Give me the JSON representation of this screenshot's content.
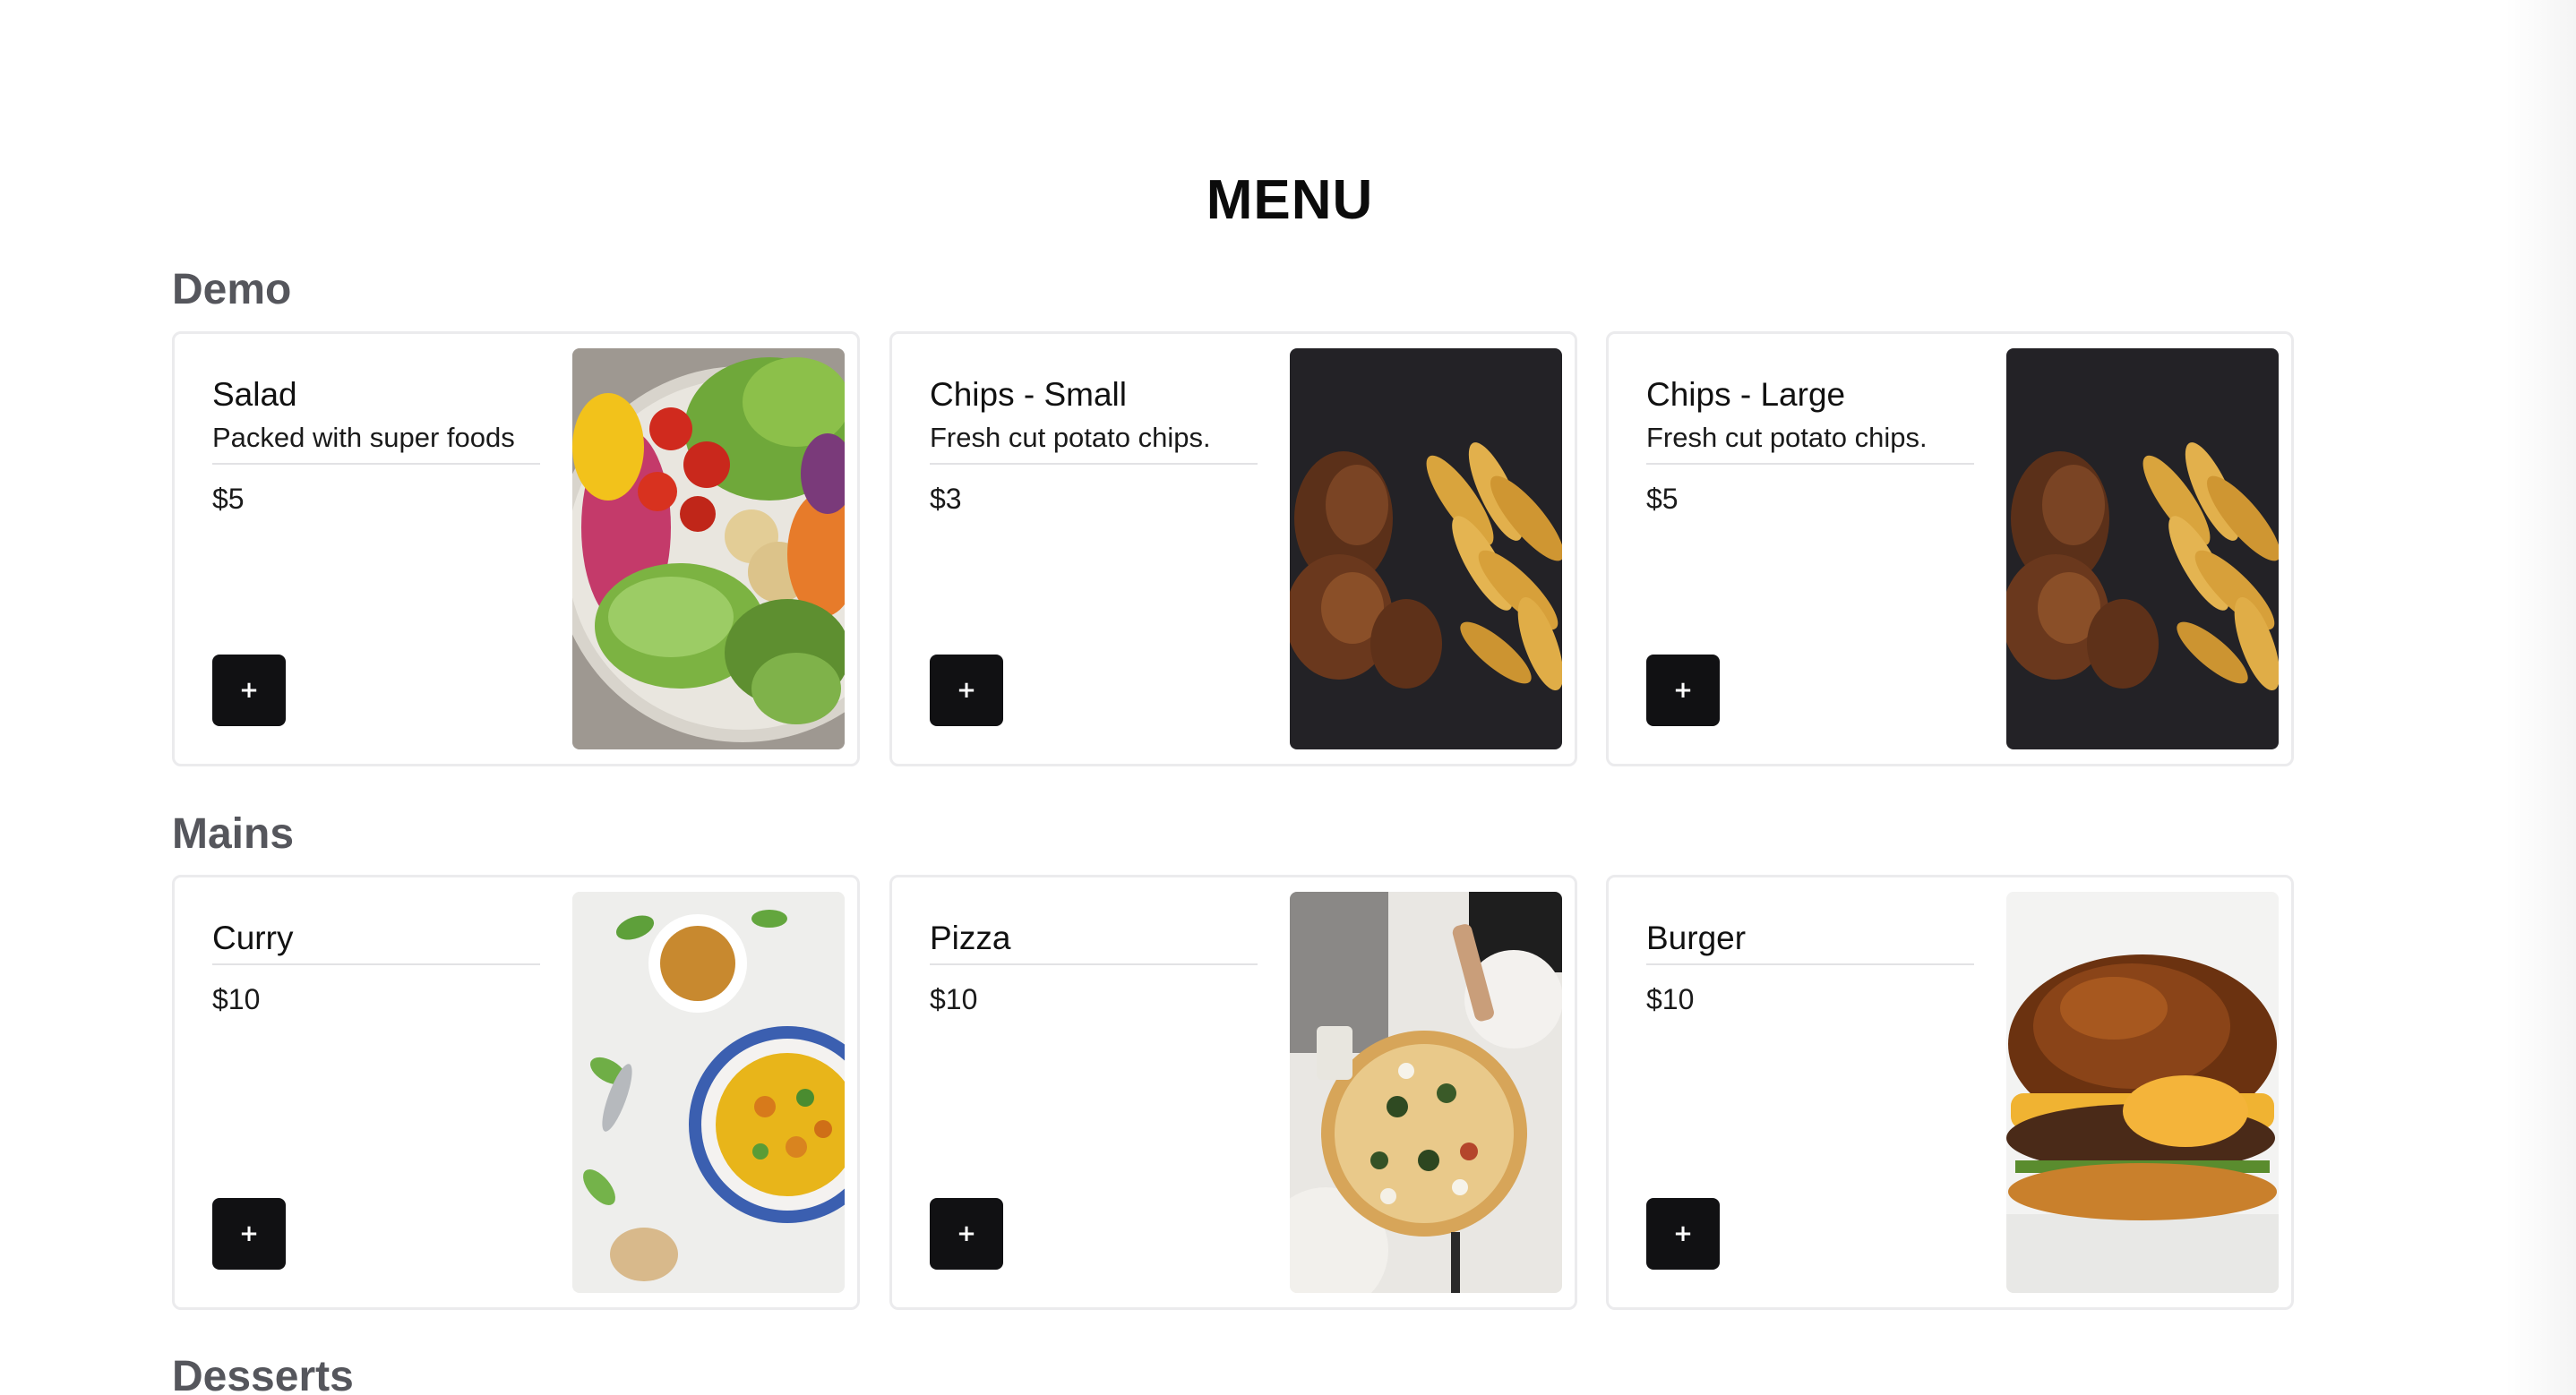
{
  "page": {
    "title": "MENU"
  },
  "sections": [
    {
      "heading": "Demo",
      "items": [
        {
          "name": "Salad",
          "description": "Packed with super foods",
          "price": "$5",
          "add_label": "+",
          "image": "salad-photo"
        },
        {
          "name": "Chips - Small",
          "description": "Fresh cut potato chips.",
          "price": "$3",
          "add_label": "+",
          "image": "chicken-wings-chips-photo"
        },
        {
          "name": "Chips - Large",
          "description": "Fresh cut potato chips.",
          "price": "$5",
          "add_label": "+",
          "image": "chicken-wings-chips-photo"
        }
      ]
    },
    {
      "heading": "Mains",
      "items": [
        {
          "name": "Curry",
          "price": "$10",
          "add_label": "+",
          "image": "curry-photo"
        },
        {
          "name": "Pizza",
          "price": "$10",
          "add_label": "+",
          "image": "pizza-photo"
        },
        {
          "name": "Burger",
          "price": "$10",
          "add_label": "+",
          "image": "burger-photo"
        }
      ]
    },
    {
      "heading": "Desserts",
      "items": []
    }
  ]
}
